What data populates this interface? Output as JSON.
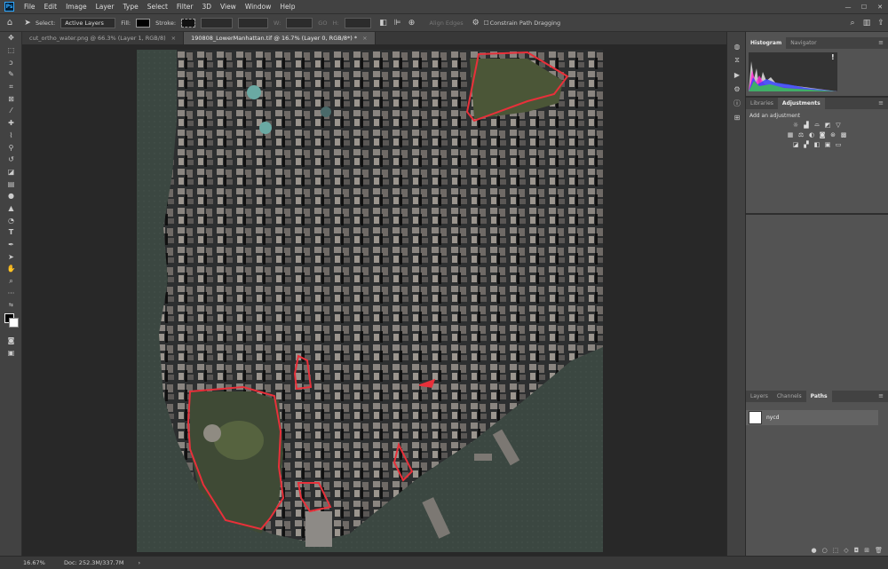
{
  "app_logo": "Ps",
  "menu": [
    "File",
    "Edit",
    "Image",
    "Layer",
    "Type",
    "Select",
    "Filter",
    "3D",
    "View",
    "Window",
    "Help"
  ],
  "options": {
    "select_label": "Select:",
    "select_value": "Active Layers",
    "fill_label": "Fill:",
    "stroke_label": "Stroke:",
    "w_label": "W:",
    "go_label": "GO",
    "h_label": "H:",
    "align_edges": "Align Edges",
    "constrain": "Constrain Path Dragging"
  },
  "tabs": [
    {
      "label": "cut_ortho_water.png @ 66.3% (Layer 1, RGB/8)",
      "close": "×",
      "active": false
    },
    {
      "label": "190808_LowerManhattan.tif @ 16.7% (Layer 0, RGB/8*) *",
      "close": "×",
      "active": true
    }
  ],
  "status": {
    "zoom": "16.67%",
    "doc": "Doc: 252.3M/337.7M",
    "arrow": "›"
  },
  "panels": {
    "top_tabs": [
      "Histogram",
      "Navigator"
    ],
    "warning": "!",
    "mid_tabs": [
      "Libraries",
      "Adjustments"
    ],
    "add_adjustment": "Add an adjustment",
    "bottom_tabs": [
      "Layers",
      "Channels",
      "Paths"
    ],
    "path_name": "nycd",
    "menu_icon": "≡"
  },
  "colors": {
    "accent": "#31a8ff",
    "selection": "#e8303a",
    "water": "#3e4a44"
  }
}
